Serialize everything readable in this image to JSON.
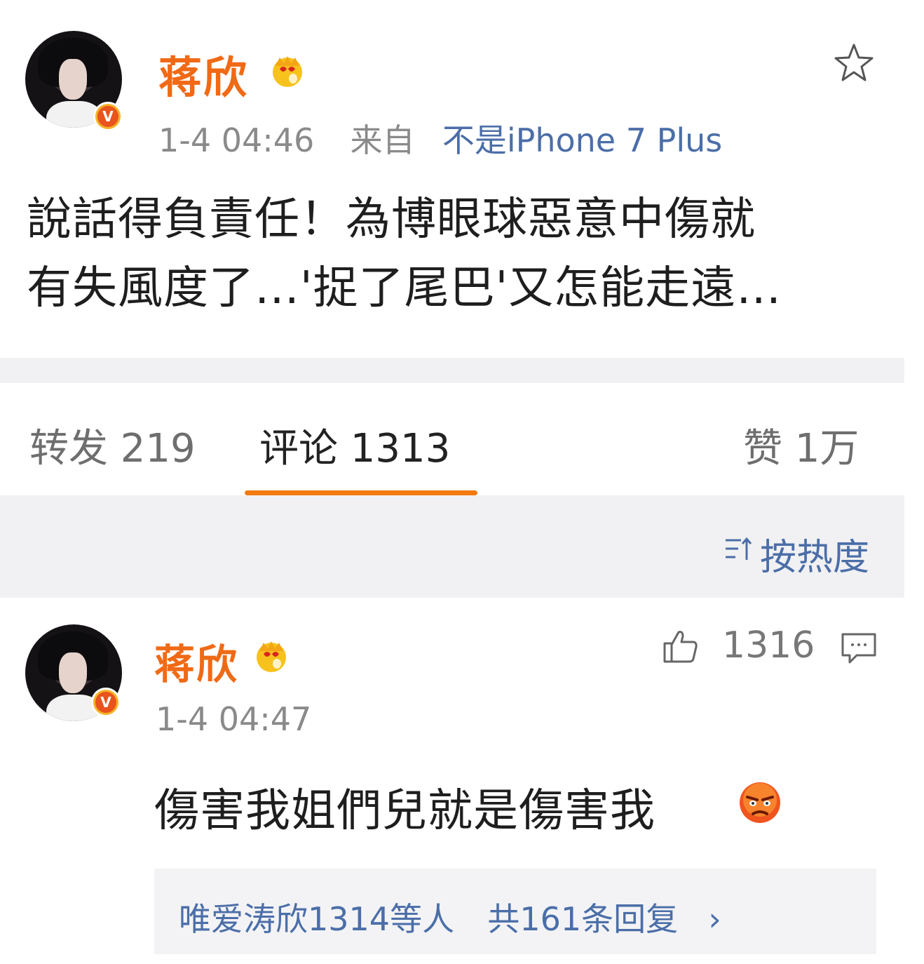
{
  "post": {
    "author": "蒋欣",
    "timestamp": "1-4 04:46",
    "source_prefix": "来自",
    "source": "不是iPhone 7 Plus",
    "text_line1": "說話得負責任！為博眼球惡意中傷就",
    "text_line2": "有失風度了…'捉了尾巴'又怎能走遠…",
    "icons": [
      "favorite-star-icon",
      "crown-emoji-icon",
      "verified-v-icon"
    ]
  },
  "tabs": {
    "repost_label": "转发 219",
    "comments_label": "评论 1313",
    "likes_label": "赞 1万"
  },
  "sort": {
    "label": "按热度",
    "icon": "sort-icon"
  },
  "comment": {
    "author": "蒋欣",
    "timestamp": "1-4 04:47",
    "like_count": "1316",
    "text": "傷害我姐們兒就是傷害我",
    "replies": {
      "users": "唯爱涛欣1314等人",
      "count": "共161条回复",
      "arrow": "›"
    },
    "icons": [
      "thumbs-up-icon",
      "reply-bubble-icon",
      "angry-emoji-icon"
    ]
  },
  "colors": {
    "accent_orange": "#f06a16",
    "link_blue": "#4b6ea8",
    "tab_underline": "#f27a10"
  }
}
